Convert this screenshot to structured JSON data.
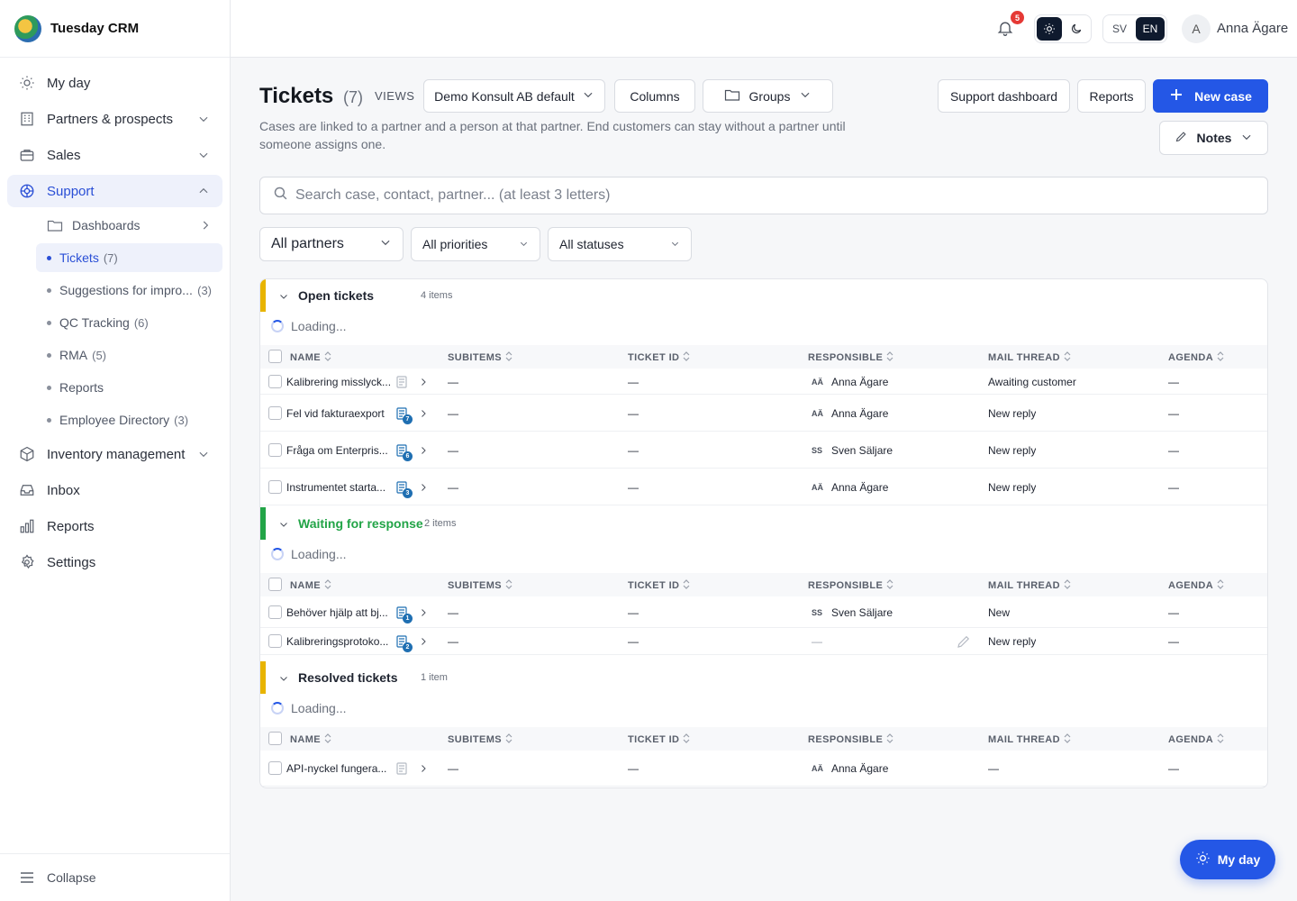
{
  "app": {
    "name": "Tuesday CRM"
  },
  "sidebar": {
    "items": [
      {
        "label": "My day",
        "icon": "sun-icon"
      },
      {
        "label": "Partners & prospects",
        "icon": "building-icon"
      },
      {
        "label": "Sales",
        "icon": "briefcase-icon"
      },
      {
        "label": "Support",
        "icon": "lifebuoy-icon"
      },
      {
        "label": "Inventory management",
        "icon": "box-icon"
      },
      {
        "label": "Inbox",
        "icon": "inbox-icon"
      },
      {
        "label": "Reports",
        "icon": "bar-chart-icon"
      },
      {
        "label": "Settings",
        "icon": "gear-icon"
      }
    ],
    "support_sub": {
      "dashboards": "Dashboards",
      "tickets": "Tickets",
      "tickets_count": "(7)",
      "suggestions": "Suggestions for impro...",
      "suggestions_count": "(3)",
      "qc": "QC Tracking",
      "qc_count": "(6)",
      "rma": "RMA",
      "rma_count": "(5)",
      "reports": "Reports",
      "employee": "Employee Directory",
      "employee_count": "(3)"
    },
    "collapse_label": "Collapse"
  },
  "topbar": {
    "notification_count": "5",
    "lang_sv": "SV",
    "lang_en": "EN",
    "avatar_initial": "A",
    "user_name": "Anna Ägare"
  },
  "header": {
    "title": "Tickets",
    "count": "(7)",
    "views_label": "VIEWS",
    "view_select": "Demo Konsult AB default",
    "columns_label": "Columns",
    "groups_label": "Groups",
    "support_dashboard_label": "Support dashboard",
    "reports_label": "Reports",
    "new_case_label": "New case",
    "notes_label": "Notes",
    "subtitle": "Cases are linked to a partner and a person at that partner. End customers can stay without a partner until someone assigns one."
  },
  "search": {
    "placeholder": "Search case, contact, partner... (at least 3 letters)"
  },
  "filters": {
    "partners": "All partners",
    "priorities": "All priorities",
    "statuses": "All statuses"
  },
  "columns": [
    "NAME",
    "SUBITEMS",
    "TICKET ID",
    "RESPONSIBLE",
    "MAIL THREAD",
    "AGENDA"
  ],
  "loading_text": "Loading...",
  "groups": [
    {
      "name": "Open tickets",
      "count": "4 items",
      "color": "#e8b400",
      "rows": [
        {
          "name": "Kalibrering misslyck...",
          "subitems": "—",
          "ticket_id": "—",
          "resp_initials": "AÄ",
          "responsible": "Anna Ägare",
          "mail": "Awaiting customer",
          "agenda": "—",
          "badge": ""
        },
        {
          "name": "Fel vid fakturaexport",
          "subitems": "—",
          "ticket_id": "—",
          "resp_initials": "AÄ",
          "responsible": "Anna Ägare",
          "mail": "New reply",
          "agenda": "—",
          "badge": "7"
        },
        {
          "name": "Fråga om Enterpris...",
          "subitems": "—",
          "ticket_id": "—",
          "resp_initials": "SS",
          "responsible": "Sven Säljare",
          "mail": "New reply",
          "agenda": "—",
          "badge": "6"
        },
        {
          "name": "Instrumentet starta...",
          "subitems": "—",
          "ticket_id": "—",
          "resp_initials": "AÄ",
          "responsible": "Anna Ägare",
          "mail": "New reply",
          "agenda": "—",
          "badge": "3"
        }
      ]
    },
    {
      "name": "Waiting for response",
      "count": "2 items",
      "color": "#22a447",
      "rows": [
        {
          "name": "Behöver hjälp att bj...",
          "subitems": "—",
          "ticket_id": "—",
          "resp_initials": "SS",
          "responsible": "Sven Säljare",
          "mail": "New",
          "agenda": "—",
          "badge": "1"
        },
        {
          "name": "Kalibreringsprotoko...",
          "subitems": "—",
          "ticket_id": "—",
          "resp_initials": "",
          "responsible": "—",
          "mail": "New reply",
          "agenda": "—",
          "badge": "2"
        }
      ]
    },
    {
      "name": "Resolved tickets",
      "count": "1 item",
      "color": "#e8b400",
      "rows": [
        {
          "name": "API-nyckel fungera...",
          "subitems": "—",
          "ticket_id": "—",
          "resp_initials": "AÄ",
          "responsible": "Anna Ägare",
          "mail": "—",
          "agenda": "—",
          "badge": ""
        }
      ]
    }
  ],
  "fab": {
    "label": "My day"
  },
  "colors": {
    "accent": "#2457e6",
    "active_bg": "#eef1fb",
    "open": "#e8b400",
    "waiting": "#22a447"
  }
}
